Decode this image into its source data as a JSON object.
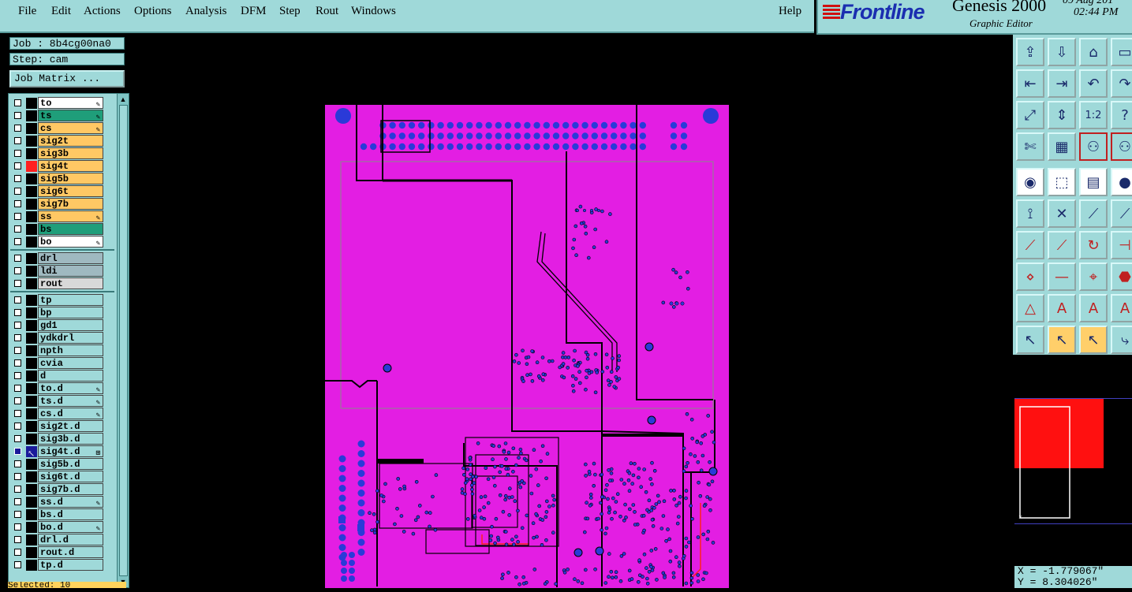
{
  "menu": {
    "items": [
      "File",
      "Edit",
      "Actions",
      "Options",
      "Analysis",
      "DFM",
      "Step",
      "Rout",
      "Windows"
    ],
    "help": "Help"
  },
  "brand": {
    "logo": "Frontline",
    "product": "Genesis 2000",
    "subtitle": "Graphic Editor",
    "date": "09 Aug 201",
    "time": "02:44 PM"
  },
  "job": {
    "job_label": "Job : 8b4cg00na0",
    "step_label": "Step: cam",
    "matrix_button": "Job Matrix ..."
  },
  "layers": {
    "board": [
      {
        "name": "to",
        "color": "#ffffff",
        "mark": "pen"
      },
      {
        "name": "ts",
        "color": "#1f9e7a",
        "mark": "pen"
      },
      {
        "name": "cs",
        "color": "#ffc864",
        "mark": "pen"
      },
      {
        "name": "sig2t",
        "color": "#ffc864",
        "mark": ""
      },
      {
        "name": "sig3b",
        "color": "#ffc864",
        "mark": ""
      },
      {
        "name": "sig4t",
        "color": "#ffc864",
        "mark": "",
        "affected": "#ff2020"
      },
      {
        "name": "sig5b",
        "color": "#ffc864",
        "mark": ""
      },
      {
        "name": "sig6t",
        "color": "#ffc864",
        "mark": ""
      },
      {
        "name": "sig7b",
        "color": "#ffc864",
        "mark": ""
      },
      {
        "name": "ss",
        "color": "#ffc864",
        "mark": "pen"
      },
      {
        "name": "bs",
        "color": "#1f9e7a",
        "mark": ""
      },
      {
        "name": "bo",
        "color": "#ffffff",
        "mark": "pen"
      }
    ],
    "drill": [
      {
        "name": "drl",
        "color": "#9fb9c0",
        "mark": ""
      },
      {
        "name": "ldi",
        "color": "#9fb9c0",
        "mark": ""
      },
      {
        "name": "rout",
        "color": "#d8d8d8",
        "mark": ""
      }
    ],
    "misc": [
      {
        "name": "tp",
        "mark": ""
      },
      {
        "name": "bp",
        "mark": ""
      },
      {
        "name": "gd1",
        "mark": ""
      },
      {
        "name": "ydkdrl",
        "mark": ""
      },
      {
        "name": "npth",
        "mark": ""
      },
      {
        "name": "cvia",
        "mark": ""
      },
      {
        "name": "d",
        "mark": ""
      },
      {
        "name": "to.d",
        "mark": "pen"
      },
      {
        "name": "ts.d",
        "mark": "pen"
      },
      {
        "name": "cs.d",
        "mark": "pen"
      },
      {
        "name": "sig2t.d",
        "mark": ""
      },
      {
        "name": "sig3b.d",
        "mark": ""
      },
      {
        "name": "sig4t.d",
        "mark": "grid",
        "work": true
      },
      {
        "name": "sig5b.d",
        "mark": ""
      },
      {
        "name": "sig6t.d",
        "mark": ""
      },
      {
        "name": "sig7b.d",
        "mark": ""
      },
      {
        "name": "ss.d",
        "mark": "pen"
      },
      {
        "name": "bs.d",
        "mark": ""
      },
      {
        "name": "bo.d",
        "mark": "pen"
      },
      {
        "name": "drl.d",
        "mark": ""
      },
      {
        "name": "rout.d",
        "mark": ""
      },
      {
        "name": "tp.d",
        "mark": ""
      }
    ]
  },
  "status": {
    "selected": "Selected: 10"
  },
  "coords": {
    "x": "X = -1.779067\"",
    "y": "Y =  8.304026\""
  },
  "tools": {
    "icons": [
      "open-job-icon",
      "save-icon",
      "home-icon",
      "partial-icon",
      "snap-left-icon",
      "snap-right-icon",
      "undo-icon",
      "redo-icon",
      "zoom-fit-icon",
      "zoom-vertical-icon",
      "zoom-1to2-icon",
      "help-icon",
      "measure-icon",
      "grid-icon",
      "pad-icon",
      "pad2-icon",
      "select-pad-icon",
      "select-region-icon",
      "ruler-icon",
      "dot-icon",
      "net-icon",
      "delete-icon",
      "add-line-icon",
      "add-arc-icon",
      "edit-line-icon",
      "move-line-icon",
      "rotate-icon",
      "split-icon",
      "node-icon",
      "cut-icon",
      "center-icon",
      "shape-icon",
      "warning-icon",
      "text-icon",
      "text-snap-icon",
      "text-alt-icon",
      "pointer-icon",
      "select-icon",
      "select-snap-icon",
      "route-icon"
    ],
    "zoom_label": "1:2"
  },
  "colors": {
    "panel": "#9fd9d9",
    "board": "#e31ee3",
    "pad": "#2a3ad8",
    "trace": "#000000",
    "highlight": "#ff2020"
  }
}
